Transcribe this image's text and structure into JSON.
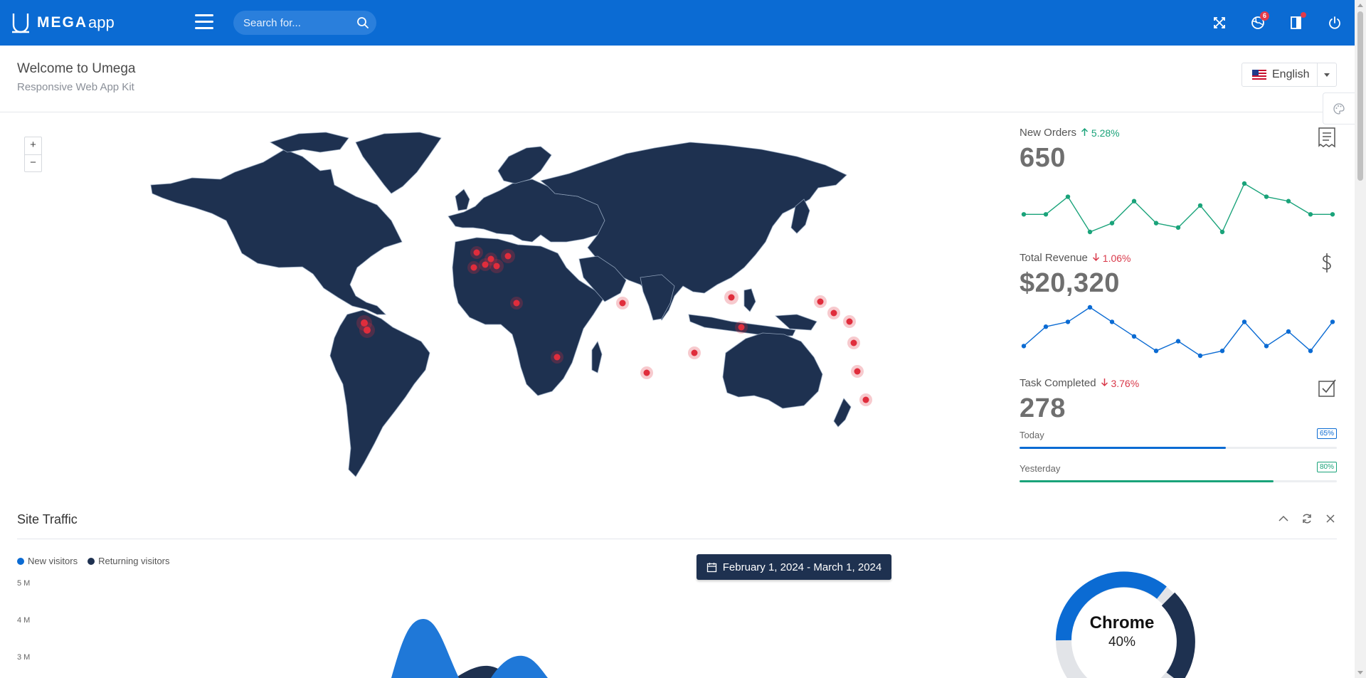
{
  "brand": {
    "mega": "MEGA",
    "app": "app",
    "logo_icon": "umega-logo-icon"
  },
  "topbar": {
    "search_placeholder": "Search for...",
    "notifications_badge": "6",
    "icons": [
      "fullscreen-icon",
      "globe-icon",
      "bookmark-icon",
      "power-icon"
    ]
  },
  "header": {
    "title": "Welcome to Umega",
    "subtitle": "Responsive Web App Kit",
    "language": "English"
  },
  "map": {
    "zoom_in": "+",
    "zoom_out": "−"
  },
  "stats": {
    "orders": {
      "label": "New Orders",
      "change": "5.28%",
      "direction": "up",
      "value": "650",
      "spark": [
        8,
        8,
        12,
        4,
        6,
        11,
        6,
        5,
        10,
        4,
        15,
        12,
        11,
        8,
        8
      ],
      "color": "#1aa37a"
    },
    "revenue": {
      "label": "Total Revenue",
      "change": "1.06%",
      "direction": "down",
      "value": "$20,320",
      "spark": [
        4,
        8,
        9,
        12,
        9,
        6,
        3,
        5,
        2,
        3,
        9,
        4,
        7,
        3,
        9
      ],
      "color": "#0b6bd3"
    },
    "tasks": {
      "label": "Task Completed",
      "change": "3.76%",
      "direction": "down",
      "value": "278",
      "today": {
        "label": "Today",
        "pct": "65%",
        "value": 0.65,
        "color": "#0b6bd3"
      },
      "yesterday": {
        "label": "Yesterday",
        "pct": "80%",
        "value": 0.8,
        "color": "#1aa37a"
      }
    }
  },
  "traffic": {
    "title": "Site Traffic",
    "legend": [
      {
        "name": "New visitors",
        "color": "#0b6bd3"
      },
      {
        "name": "Returning visitors",
        "color": "#1e3150"
      }
    ],
    "y_ticks": [
      "5 M",
      "4 M",
      "3 M"
    ],
    "date_range": "February 1, 2024 - March 1, 2024",
    "donut": {
      "label": "Chrome",
      "pct": "40%",
      "value": 0.4
    }
  },
  "colors": {
    "primary": "#0b6bd3",
    "dark": "#1e3150",
    "success": "#1aa37a",
    "danger": "#d9394a",
    "marker": "#e02d3c"
  }
}
